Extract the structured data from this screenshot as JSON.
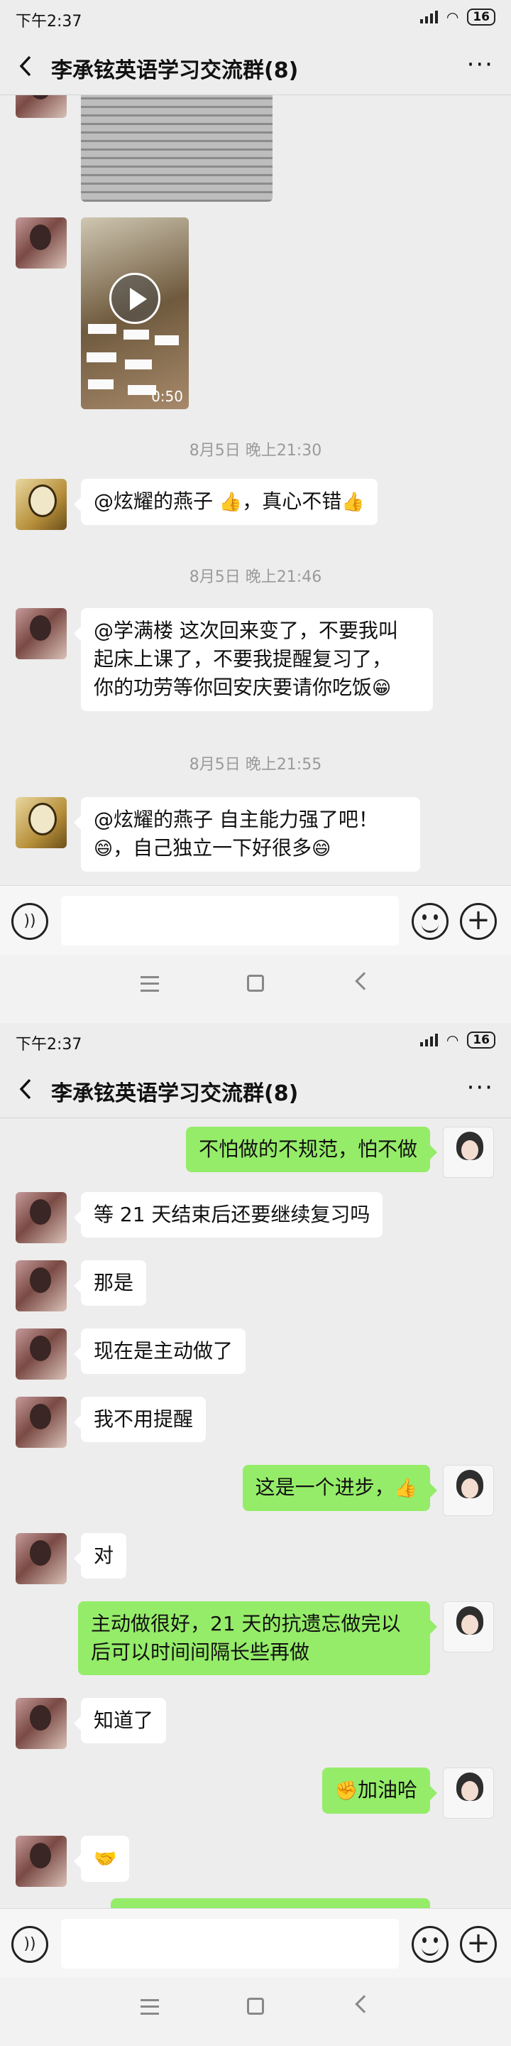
{
  "screen1": {
    "status": {
      "time": "下午2:37",
      "battery": "16"
    },
    "header": {
      "title": "李承铉英语学习交流群(8)"
    },
    "video": {
      "duration": "0:50"
    },
    "messages": [
      {
        "time": "8月5日 晚上21:30"
      },
      {
        "text_a": "@炫耀的燕子 ",
        "text_b": "，真心不错"
      },
      {
        "time": "8月5日 晚上21:46"
      },
      {
        "line1": "@学满楼  这次回来变了，不要我叫",
        "line2": "起床上课了，不要我提醒复习了，",
        "line3": "你的功劳等你回安庆要请你吃饭"
      },
      {
        "time": "8月5日 晚上21:55"
      },
      {
        "line1": "@炫耀的燕子  自主能力强了吧！",
        "line2": "，自己独立一下好很多"
      }
    ]
  },
  "screen2": {
    "status": {
      "time": "下午2:37",
      "battery": "16"
    },
    "header": {
      "title": "李承铉英语学习交流群(8)"
    },
    "messages": [
      {
        "text": "不怕做的不规范，怕不做"
      },
      {
        "text": "等 21 天结束后还要继续复习吗"
      },
      {
        "text": "那是"
      },
      {
        "text": "现在是主动做了"
      },
      {
        "text": "我不用提醒"
      },
      {
        "text": "这是一个进步，"
      },
      {
        "text": "对"
      },
      {
        "line1": "主动做很好，21 天的抗遗忘做完以",
        "line2": "后可以时间间隔长些再做"
      },
      {
        "text": "知道了"
      },
      {
        "text": "加油哈"
      }
    ]
  },
  "icons": {
    "thumbs_up": "👍",
    "grin": "😁",
    "smile": "😄",
    "fist": "✊",
    "handshake": "🤝",
    "voice": "))",
    "plus": "+"
  },
  "colors": {
    "bubble_mine": "#95ec69",
    "bubble_other": "#ffffff",
    "background": "#ededed"
  }
}
